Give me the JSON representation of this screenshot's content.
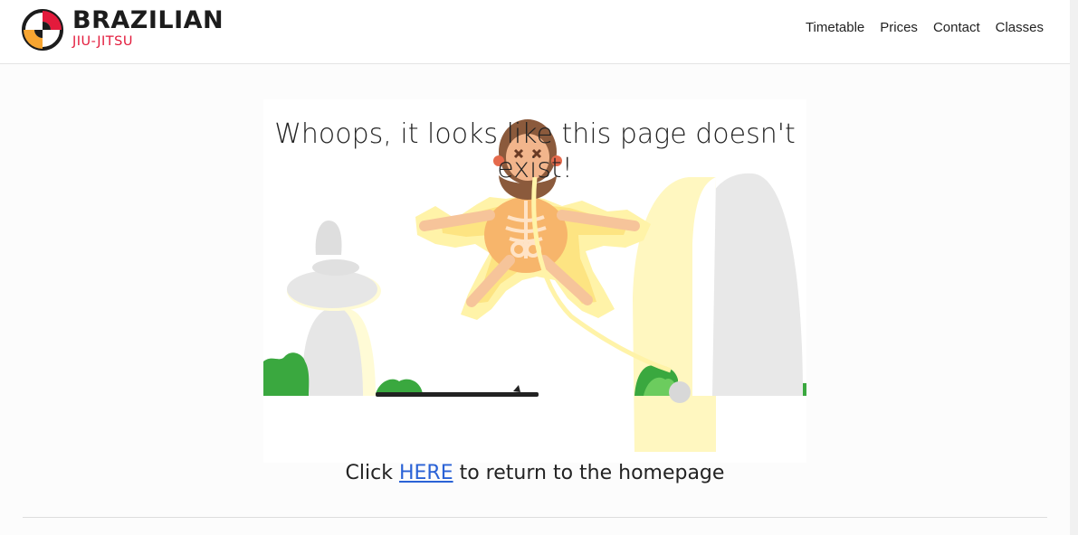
{
  "brand": {
    "name": "BRAZILIAN",
    "sub": "JIU-JITSU",
    "colors": {
      "red": "#e31b3c",
      "orange": "#f7a531",
      "dark": "#1c1c1c"
    }
  },
  "nav": [
    {
      "label": "Timetable"
    },
    {
      "label": "Prices"
    },
    {
      "label": "Contact"
    },
    {
      "label": "Classes"
    }
  ],
  "error": {
    "title": "Whoops, it looks like this page doesn't exist!",
    "cta_prefix": "Click ",
    "cta_link": "HERE",
    "cta_suffix": " to return to the homepage"
  },
  "colors": {
    "link": "#2a62d6",
    "glow": "#fff3a8",
    "bush": "#3aa83f",
    "rock": "#e8e8e8"
  },
  "icons": [
    "logo-mark-icon"
  ]
}
